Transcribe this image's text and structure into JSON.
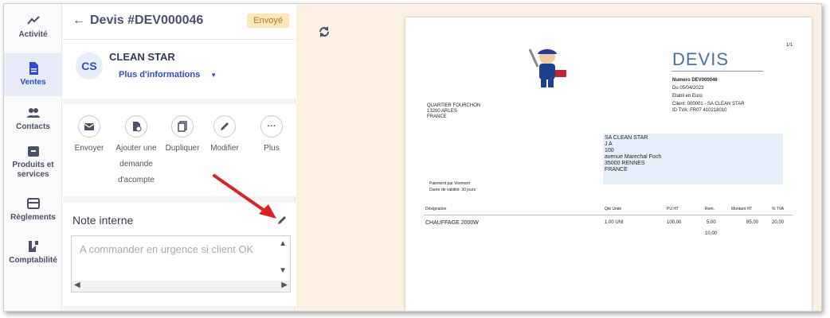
{
  "nav": {
    "items": [
      {
        "label": "Activité",
        "icon": "activity-icon"
      },
      {
        "label": "Ventes",
        "icon": "document-icon"
      },
      {
        "label": "Contacts",
        "icon": "contacts-icon"
      },
      {
        "label": "Produits et services",
        "icon": "product-icon"
      },
      {
        "label": "Règlements",
        "icon": "card-icon"
      },
      {
        "label": "Comptabilité",
        "icon": "accounting-icon"
      }
    ]
  },
  "header": {
    "back_label": "←",
    "title": "Devis #DEV000046",
    "status": "Envoyé"
  },
  "client": {
    "initials": "CS",
    "name": "CLEAN STAR",
    "more_info": "Plus d'informations"
  },
  "actions": [
    {
      "label": "Envoyer",
      "icon": "mail-icon"
    },
    {
      "label": "Ajouter une demande d'acompte",
      "icon": "deposit-icon"
    },
    {
      "label": "Dupliquer",
      "icon": "duplicate-icon"
    },
    {
      "label": "Modifier",
      "icon": "pencil-icon"
    },
    {
      "label": "Plus",
      "icon": "more-icon"
    }
  ],
  "note": {
    "title": "Note interne",
    "text": "A commander en urgence si client OK"
  },
  "document": {
    "page": "1/1",
    "title": "DEVIS",
    "numero": "Numero DEV000046",
    "date": "Du 05/04/2023",
    "devise": "Etabli en Euro",
    "client_ref": "Client: 000001 - SA CLEAN STAR",
    "tva_id": "ID TVA: FR07 410218010",
    "sender": [
      "QUARTIER FOURCHON",
      "13200 ARLES",
      "FRANCE"
    ],
    "recipient": [
      "SA CLEAN STAR",
      "J A",
      "100",
      "avenue Marechal Foch",
      "35000 RENNES",
      "FRANCE"
    ],
    "payment": "Paiement par Virement",
    "validity": "Durée de validité: 30 jours",
    "columns": [
      "Désignation",
      "Qté Unité",
      "PU HT",
      "Rem.",
      "Montant HT",
      "% TVA"
    ],
    "rows": [
      {
        "designation": "CHAUFFAGE 2000W",
        "qte": "1,00 UNI",
        "pu": "100,00",
        "rem": "5,00",
        "montant": "85,00",
        "tva": "20,00"
      }
    ],
    "rem_extra": "10,00"
  },
  "colors": {
    "accent": "#2a4bd7",
    "badge_bg": "#fde7b9",
    "badge_text": "#b07b15",
    "preview_bg": "#fbf0e1",
    "devis_blue": "#4a6fa5",
    "arrow": "#e02020"
  }
}
